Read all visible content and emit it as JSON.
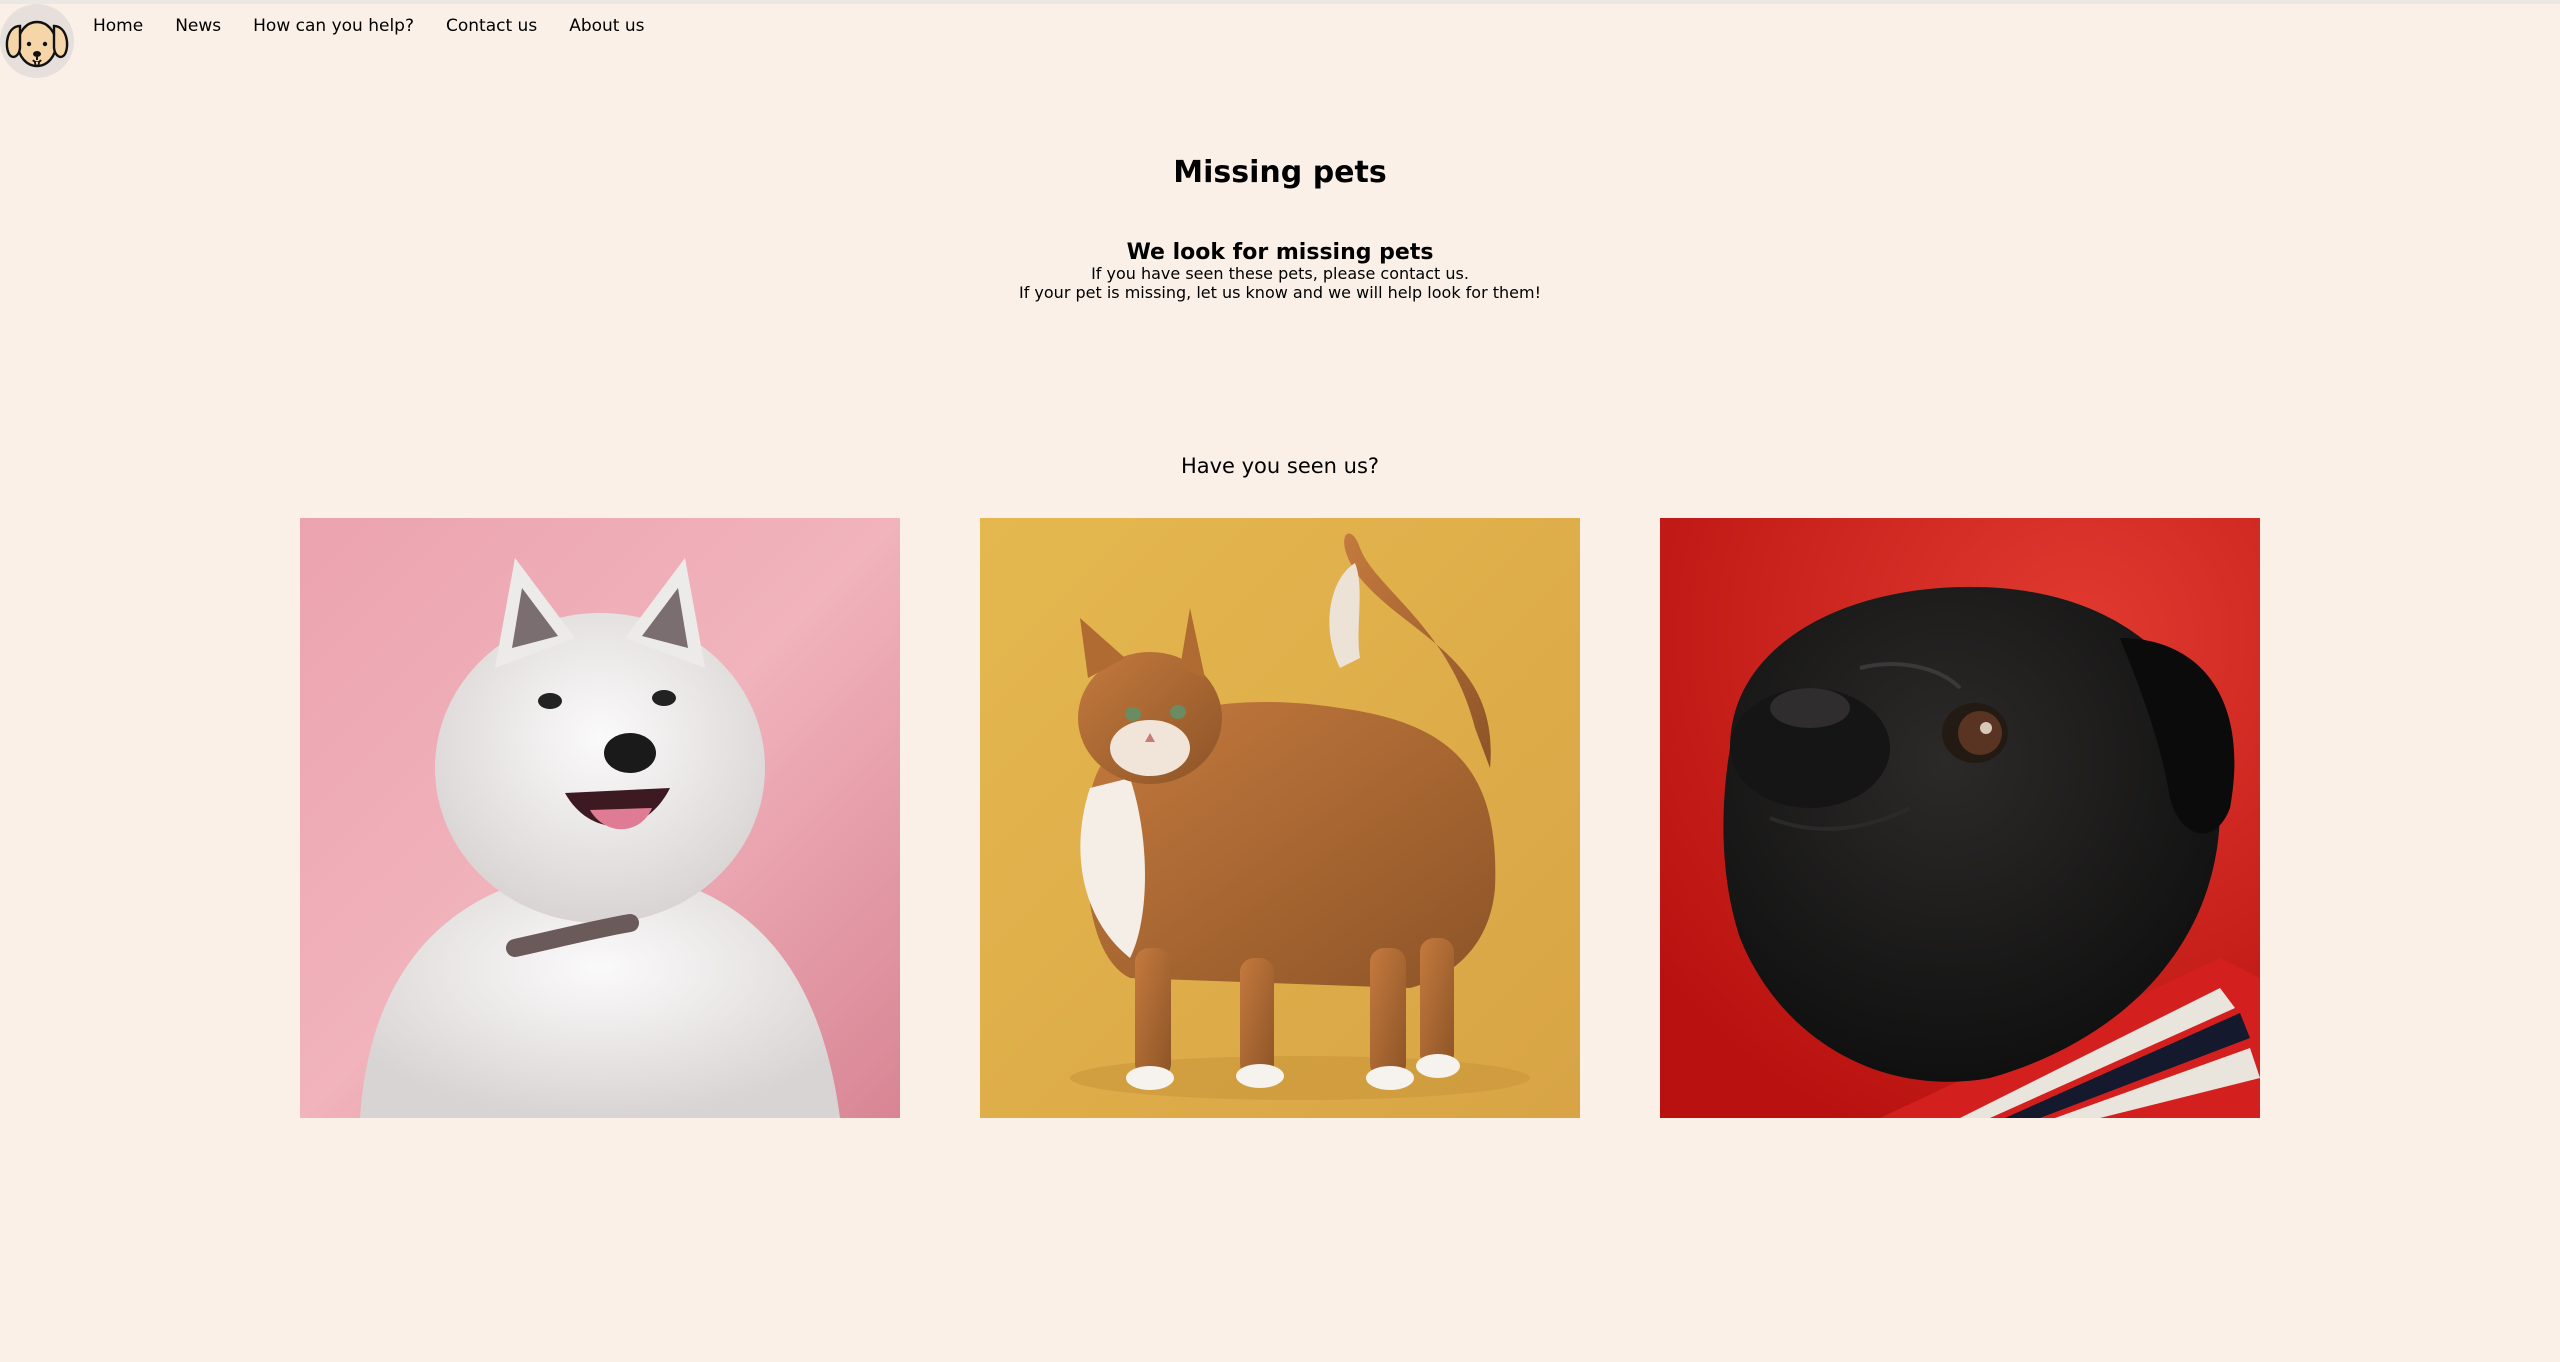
{
  "nav": {
    "logo_icon": "dog-face-icon",
    "items": [
      {
        "label": "Home"
      },
      {
        "label": "News"
      },
      {
        "label": "How can you help?"
      },
      {
        "label": "Contact us"
      },
      {
        "label": "About us"
      }
    ]
  },
  "main": {
    "title": "Missing pets",
    "intro": {
      "heading": "We look for missing pets",
      "line1": "If you have seen these pets, please contact us.",
      "line2": "If your pet is missing, let us know and we will help look for them!"
    },
    "gallery": {
      "heading": "Have you seen us?",
      "pets": [
        {
          "icon": "white-samoyed-dog-photo",
          "background": "#eba3af"
        },
        {
          "icon": "orange-tabby-cat-photo",
          "background": "#e2b54f"
        },
        {
          "icon": "black-pug-dog-photo",
          "background": "#d21e1c"
        }
      ]
    }
  },
  "colors": {
    "page_background": "#faf0e7",
    "text": "#000000"
  }
}
